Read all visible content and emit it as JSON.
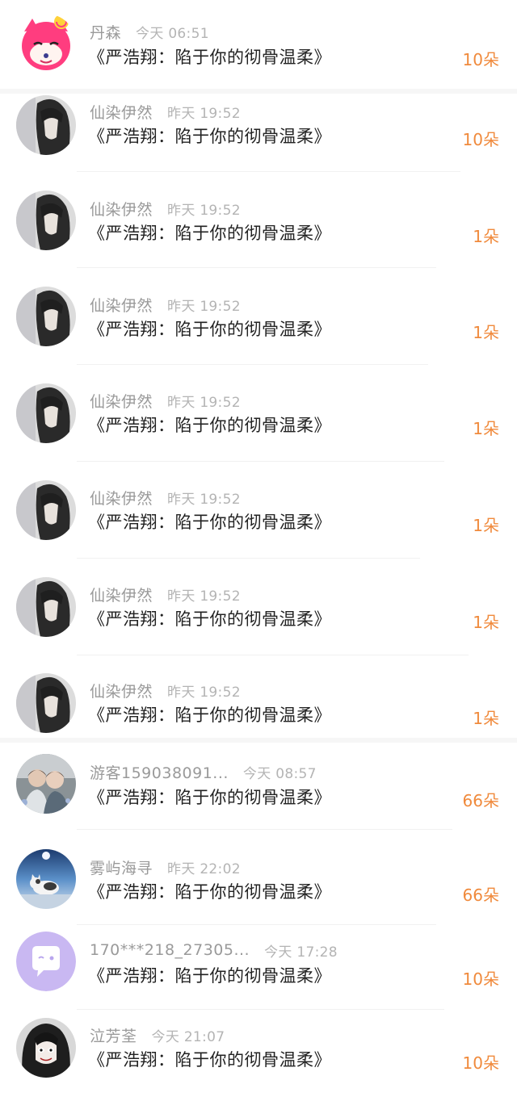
{
  "colors": {
    "amount": "#f08a3c",
    "name": "#9a9a9a",
    "time": "#b4b4b4",
    "title": "#222222"
  },
  "rows": [
    {
      "name": "丹森",
      "time": "今天 06:51",
      "book": "《严浩翔：陷于你的彻骨温柔》",
      "amount": "10朵",
      "avatar": "cartoon-fox-avatar"
    },
    {
      "name": "仙染伊然",
      "time": "昨天 19:52",
      "book": "《严浩翔：陷于你的彻骨温柔》",
      "amount": "10朵",
      "avatar": "girl-photo-avatar"
    },
    {
      "name": "仙染伊然",
      "time": "昨天 19:52",
      "book": "《严浩翔：陷于你的彻骨温柔》",
      "amount": "1朵",
      "avatar": "girl-photo-avatar"
    },
    {
      "name": "仙染伊然",
      "time": "昨天 19:52",
      "book": "《严浩翔：陷于你的彻骨温柔》",
      "amount": "1朵",
      "avatar": "girl-photo-avatar"
    },
    {
      "name": "仙染伊然",
      "time": "昨天 19:52",
      "book": "《严浩翔：陷于你的彻骨温柔》",
      "amount": "1朵",
      "avatar": "girl-photo-avatar"
    },
    {
      "name": "仙染伊然",
      "time": "昨天 19:52",
      "book": "《严浩翔：陷于你的彻骨温柔》",
      "amount": "1朵",
      "avatar": "girl-photo-avatar"
    },
    {
      "name": "仙染伊然",
      "time": "昨天 19:52",
      "book": "《严浩翔：陷于你的彻骨温柔》",
      "amount": "1朵",
      "avatar": "girl-photo-avatar"
    },
    {
      "name": "仙染伊然",
      "time": "昨天 19:52",
      "book": "《严浩翔：陷于你的彻骨温柔》",
      "amount": "1朵",
      "avatar": "girl-photo-avatar"
    },
    {
      "name": "游客159038091...",
      "time": "今天 08:57",
      "book": "《严浩翔：陷于你的彻骨温柔》",
      "amount": "66朵",
      "avatar": "two-boys-photo-avatar"
    },
    {
      "name": "雾屿海寻",
      "time": "昨天 22:02",
      "book": "《严浩翔：陷于你的彻骨温柔》",
      "amount": "66朵",
      "avatar": "cat-photo-avatar"
    },
    {
      "name": "170***218_27305...",
      "time": "今天 17:28",
      "book": "《严浩翔：陷于你的彻骨温柔》",
      "amount": "10朵",
      "avatar": "purple-chat-bubble-avatar"
    },
    {
      "name": "泣芳荃",
      "time": "今天 21:07",
      "book": "《严浩翔：陷于你的彻骨温柔》",
      "amount": "10朵",
      "avatar": "anime-girl-avatar"
    }
  ]
}
